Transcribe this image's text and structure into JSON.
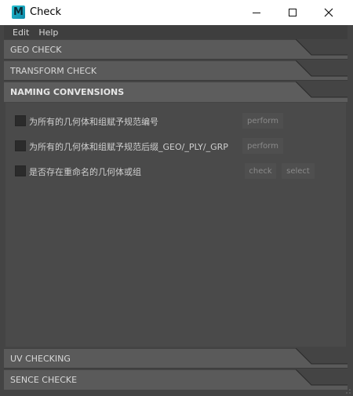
{
  "window": {
    "title": "Check",
    "app_icon_letter": "M",
    "controls": [
      "minimize",
      "maximize",
      "close"
    ]
  },
  "menubar": {
    "items": [
      {
        "label": "Edit"
      },
      {
        "label": "Help"
      }
    ]
  },
  "frames": [
    {
      "label": "GEO CHECK",
      "expanded": false
    },
    {
      "label": "TRANSFORM CHECK",
      "expanded": false
    },
    {
      "label": "NAMING CONVENSIONS",
      "expanded": true
    },
    {
      "label": "UV CHECKING",
      "expanded": false
    },
    {
      "label": "SENCE CHECKE",
      "expanded": false
    }
  ],
  "naming_rows": [
    {
      "label": "为所有的几何体和组赋予规范编号",
      "checked": false,
      "buttons": [
        "perform"
      ]
    },
    {
      "label": "为所有的几何体和组赋予规范后缀_GEO/_PLY/_GRP",
      "checked": false,
      "buttons": [
        "perform"
      ]
    },
    {
      "label": "是否存在重命名的几何体或组",
      "checked": false,
      "buttons": [
        "check",
        "select"
      ]
    }
  ],
  "colors": {
    "background": "#444444",
    "content": "#4a4a4a",
    "header": "#5d5d5d",
    "button": "#4f4f4f",
    "button_text": "#8a8a8a"
  }
}
